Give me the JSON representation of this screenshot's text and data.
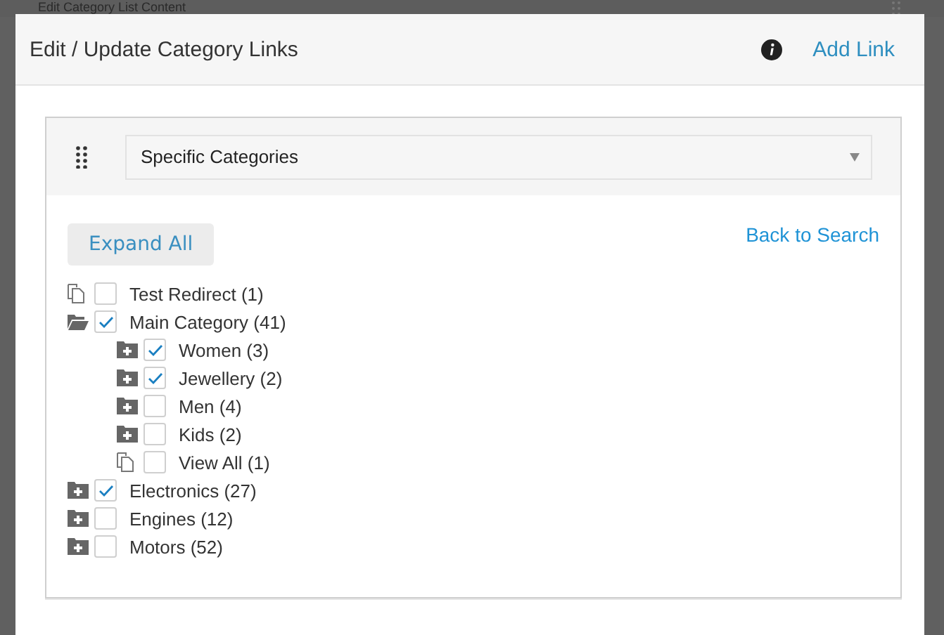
{
  "background_page": {
    "title": "Edit Category List Content"
  },
  "dialog": {
    "title": "Edit / Update Category Links",
    "add_link": "Add Link"
  },
  "selector": {
    "value": "Specific Categories"
  },
  "expand_all": "Expand All",
  "back_to_search": "Back to Search",
  "tree": [
    {
      "label": "Test Redirect (1)",
      "kind": "page",
      "checked": false
    },
    {
      "label": "Main Category (41)",
      "kind": "folder",
      "expanded": true,
      "checked": true,
      "children": [
        {
          "label": "Women (3)",
          "kind": "folder",
          "expanded": false,
          "checked": true
        },
        {
          "label": "Jewellery (2)",
          "kind": "folder",
          "expanded": false,
          "checked": true
        },
        {
          "label": "Men (4)",
          "kind": "folder",
          "expanded": false,
          "checked": false
        },
        {
          "label": "Kids (2)",
          "kind": "folder",
          "expanded": false,
          "checked": false
        },
        {
          "label": "View All (1)",
          "kind": "page",
          "checked": false
        }
      ]
    },
    {
      "label": "Electronics (27)",
      "kind": "folder",
      "expanded": false,
      "checked": true
    },
    {
      "label": "Engines (12)",
      "kind": "folder",
      "expanded": false,
      "checked": false
    },
    {
      "label": "Motors (52)",
      "kind": "folder",
      "expanded": false,
      "checked": false
    }
  ]
}
